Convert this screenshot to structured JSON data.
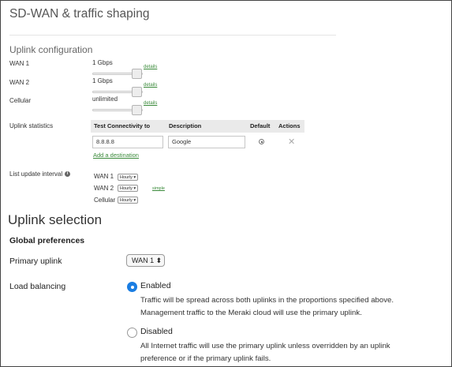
{
  "page": {
    "title": "SD-WAN & traffic shaping"
  },
  "uplink_config": {
    "heading": "Uplink configuration",
    "rows": [
      {
        "label": "WAN 1",
        "value": "1 Gbps",
        "details": "details"
      },
      {
        "label": "WAN 2",
        "value": "1 Gbps",
        "details": "details"
      },
      {
        "label": "Cellular",
        "value": "unlimited",
        "details": "details"
      }
    ]
  },
  "uplink_stats": {
    "label": "Uplink statistics",
    "columns": [
      "Test Connectivity to",
      "Description",
      "Default",
      "Actions"
    ],
    "row": {
      "target": "8.8.8.8",
      "description": "Google"
    },
    "add_destination": "Add a destination"
  },
  "list_update": {
    "label": "List update interval",
    "items": [
      {
        "label": "WAN 1",
        "value": "Hourly"
      },
      {
        "label": "WAN 2",
        "value": "Hourly"
      },
      {
        "label": "Cellular",
        "value": "Hourly"
      }
    ],
    "simple_link": "simple"
  },
  "uplink_selection": {
    "heading": "Uplink selection",
    "global_prefs": "Global preferences",
    "primary_uplink": {
      "label": "Primary uplink",
      "value": "WAN 1"
    },
    "load_balancing": {
      "label": "Load balancing",
      "enabled": {
        "label": "Enabled",
        "desc1": "Traffic will be spread across both uplinks in the proportions specified above.",
        "desc2": "Management traffic to the Meraki cloud will use the primary uplink."
      },
      "disabled": {
        "label": "Disabled",
        "desc1": "All Internet traffic will use the primary uplink unless overridden by an uplink",
        "desc2": "preference or if the primary uplink fails."
      }
    }
  },
  "colors": {
    "accent": "#1a7de2",
    "link": "#3a8a3a"
  }
}
